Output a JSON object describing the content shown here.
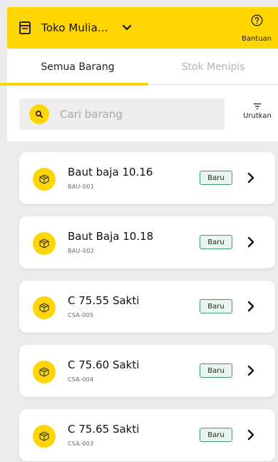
{
  "header": {
    "store_name": "Toko Mulia...",
    "help_label": "Bantuan"
  },
  "tabs": [
    {
      "label": "Semua Barang",
      "active": true
    },
    {
      "label": "Stok Menipis",
      "active": false
    }
  ],
  "search": {
    "placeholder": "Cari barang",
    "value": ""
  },
  "sort": {
    "label": "Urutkan"
  },
  "items": [
    {
      "name": "Baut baja 10.16",
      "code": "BAU-001",
      "badge": "Baru"
    },
    {
      "name": "Baut Baja 10.18",
      "code": "BAU-002",
      "badge": "Baru"
    },
    {
      "name": "C 75.55 Sakti",
      "code": "CSA-005",
      "badge": "Baru"
    },
    {
      "name": "C 75.60 Sakti",
      "code": "CSA-004",
      "badge": "Baru"
    },
    {
      "name": "C 75.65 Sakti",
      "code": "CSA-003",
      "badge": "Baru"
    }
  ],
  "colors": {
    "accent": "#ffd503",
    "badge_border": "#3b9b6e",
    "badge_bg": "#e8f6ee"
  },
  "icons": {
    "store": "store-icon",
    "dropdown": "chevron-down-icon",
    "help": "help-circle-icon",
    "search": "search-icon",
    "sort": "sort-icon",
    "item": "box-icon",
    "item_action": "chevron-right-icon"
  }
}
